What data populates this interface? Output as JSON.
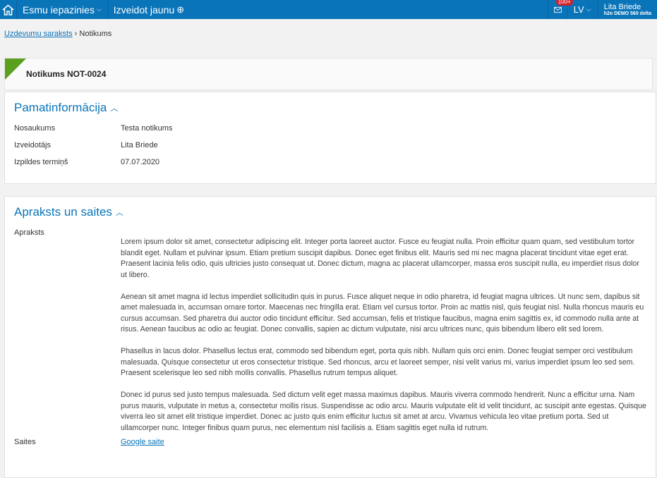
{
  "topbar": {
    "menu_acknowledged": "Esmu iepazinies",
    "menu_create": "Izveidot jaunu",
    "mail_badge": "100+",
    "language": "LV",
    "user_name": "Lita Briede",
    "org": "h2o DEMO 560 delta"
  },
  "breadcrumb": {
    "parent": "Uzdevumu saraksts",
    "separator": "›",
    "current": "Notikums"
  },
  "record": {
    "title": "Notikums NOT-0024",
    "accent": "#5aa01e"
  },
  "basic": {
    "title": "Pamatinformācija",
    "fields": [
      {
        "label": "Nosaukums",
        "value": "Testa notikums"
      },
      {
        "label": "Izveidotājs",
        "value": "Lita Briede"
      },
      {
        "label": "Izpildes termiņš",
        "value": "07.07.2020"
      }
    ]
  },
  "description": {
    "title": "Apraksts un saites",
    "label": "Apraksts",
    "paragraphs": [
      "Lorem ipsum dolor sit amet, consectetur adipiscing elit. Integer porta laoreet auctor. Fusce eu feugiat nulla. Proin efficitur quam quam, sed vestibulum tortor blandit eget. Nullam et pulvinar ipsum. Etiam pretium suscipit dapibus. Donec eget finibus elit. Mauris sed mi nec magna placerat tincidunt vitae eget erat. Praesent lacinia felis odio, quis ultricies justo consequat ut. Donec dictum, magna ac placerat ullamcorper, massa eros suscipit nulla, eu imperdiet risus dolor ut libero.",
      "Aenean sit amet magna id lectus imperdiet sollicitudin quis in purus. Fusce aliquet neque in odio pharetra, id feugiat magna ultrices. Ut nunc sem, dapibus sit amet malesuada in, accumsan ornare tortor. Maecenas nec fringilla erat. Etiam vel cursus tortor. Proin ac mattis nisl, quis feugiat nisl. Nulla rhoncus mauris eu cursus accumsan. Sed pharetra dui auctor odio tincidunt efficitur. Sed accumsan, felis et tristique faucibus, magna enim sagittis ex, id commodo nulla ante at risus. Aenean faucibus ac odio ac feugiat. Donec convallis, sapien ac dictum vulputate, nisi arcu ultrices nunc, quis bibendum libero elit sed lorem.",
      "Phasellus in lacus dolor. Phasellus lectus erat, commodo sed bibendum eget, porta quis nibh. Nullam quis orci enim. Donec feugiat semper orci vestibulum malesuada. Quisque consectetur ut eros consectetur tristique. Sed rhoncus, arcu et laoreet semper, nisi velit varius mi, varius imperdiet ipsum leo sed sem. Praesent scelerisque leo sed nibh mollis convallis. Phasellus rutrum tempus aliquet.",
      "Donec id purus sed justo tempus malesuada. Sed dictum velit eget massa maximus dapibus. Mauris viverra commodo hendrerit. Nunc a efficitur urna. Nam purus mauris, vulputate in metus a, consectetur mollis risus. Suspendisse ac odio arcu. Mauris vulputate elit id velit tincidunt, ac suscipit ante egestas. Quisque viverra leo sit amet elit tristique imperdiet. Donec ac justo quis enim efficitur luctus sit amet at arcu. Vivamus vehicula leo vitae pretium porta. Sed ut ullamcorper nunc. Integer finibus quam purus, nec elementum nisl facilisis a. Etiam sagittis eget nulla id rutrum."
    ],
    "links_label": "Saites",
    "link": "Google saite"
  }
}
